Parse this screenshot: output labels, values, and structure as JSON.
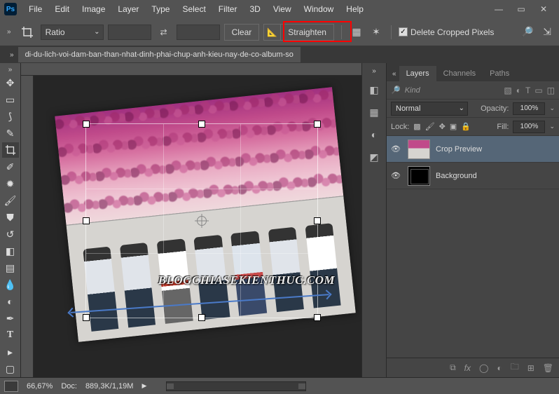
{
  "app": {
    "logo_text": "Ps"
  },
  "menubar": {
    "items": [
      "File",
      "Edit",
      "Image",
      "Layer",
      "Type",
      "Select",
      "Filter",
      "3D",
      "View",
      "Window",
      "Help"
    ]
  },
  "window_controls": {
    "minimize": "—",
    "maximize": "▭",
    "close": "✕"
  },
  "options_bar": {
    "ratio_mode": "Ratio",
    "clear_label": "Clear",
    "straighten_label": "Straighten",
    "delete_cropped_label": "Delete Cropped Pixels"
  },
  "document_tab": {
    "title": "di-du-lich-voi-dam-ban-than-nhat-dinh-phai-chup-anh-kieu-nay-de-co-album-so"
  },
  "watermark": "BLOGCHIASEKIENTHUC.COM",
  "layers_panel": {
    "tabs": [
      "Layers",
      "Channels",
      "Paths"
    ],
    "filter_label": "Kind",
    "blend_mode": "Normal",
    "opacity_label": "Opacity:",
    "opacity_value": "100%",
    "lock_label": "Lock:",
    "fill_label": "Fill:",
    "fill_value": "100%",
    "layers": [
      {
        "name": "Crop Preview"
      },
      {
        "name": "Background"
      }
    ]
  },
  "status_bar": {
    "zoom": "66,67%",
    "doc_info_label": "Doc:",
    "doc_info_value": "889,3K/1,19M"
  }
}
